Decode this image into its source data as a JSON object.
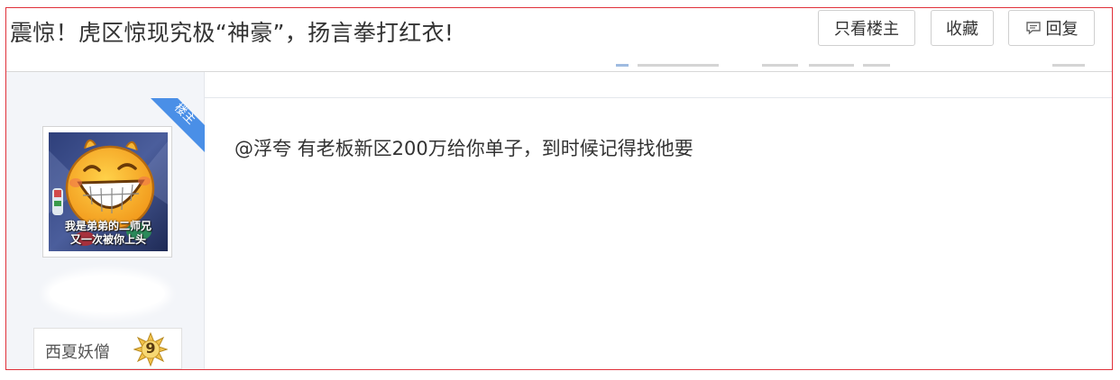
{
  "thread": {
    "title": "震惊！虎区惊现究极“神豪”，扬言拳打红衣!"
  },
  "toolbar": {
    "only_op_label": "只看楼主",
    "favorite_label": "收藏",
    "reply_label": "回复"
  },
  "post": {
    "op_badge": "楼主",
    "author": {
      "name": "西夏妖僧",
      "level": "9",
      "avatar_caption_line1": "我是弟弟的二师兄",
      "avatar_caption_line2": "又一次被你上头"
    },
    "content": "@浮夸 有老板新区200万给你单子，到时候记得找他要"
  },
  "colors": {
    "frame_border": "#e0303a",
    "op_badge_bg": "#4a8fe7",
    "level_badge": "#f0c040",
    "sidebar_bg": "#f3f5f9"
  },
  "icons": {
    "reply": "comment-icon",
    "level": "star-badge-icon",
    "avatar": "laughing-emoji-avatar"
  }
}
